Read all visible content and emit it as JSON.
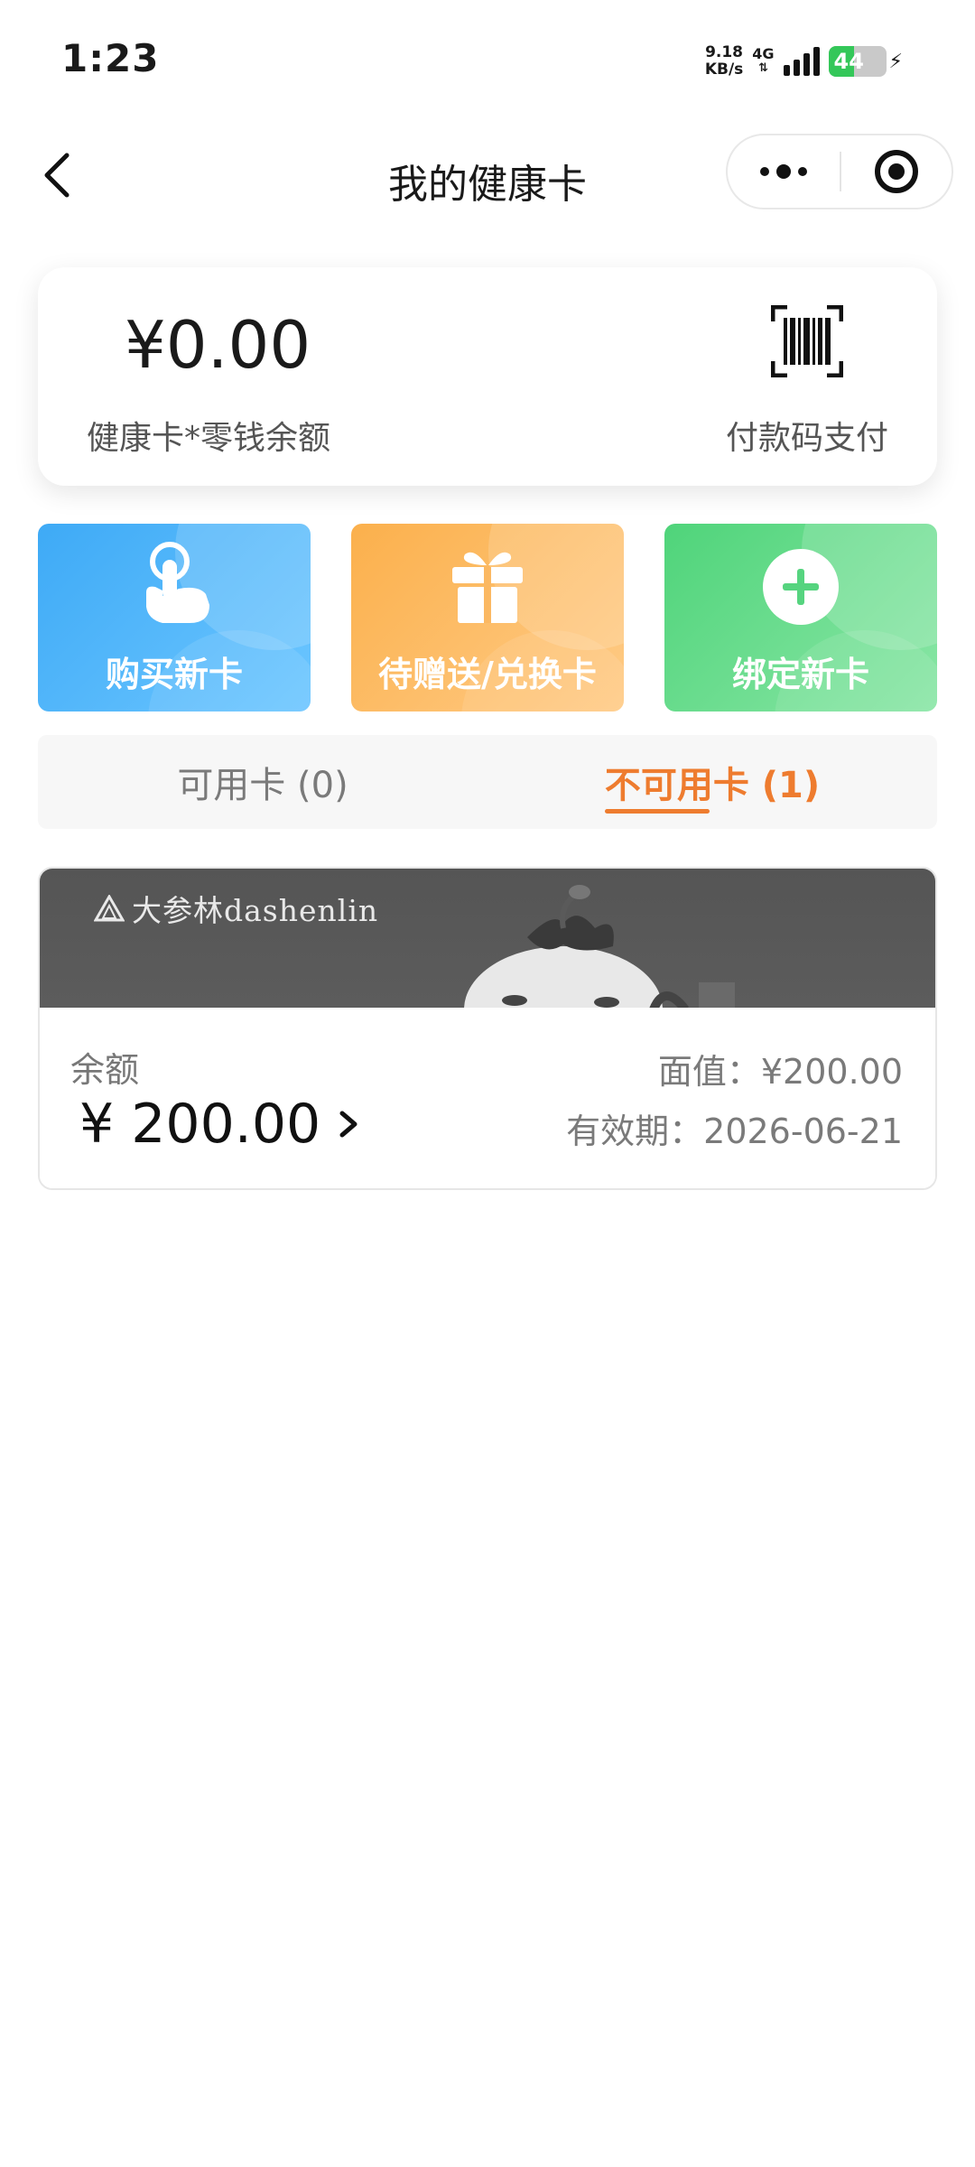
{
  "status_bar": {
    "time": "1:23",
    "net_speed_value": "9.18",
    "net_speed_unit": "KB/s",
    "network": "4G",
    "battery": "44",
    "battery_level": 0.44
  },
  "nav": {
    "title": "我的健康卡",
    "back_icon": "chevron-left-icon",
    "more_icon": "more-dots-icon",
    "close_icon": "target-circle-icon"
  },
  "balance": {
    "amount": "¥0.00",
    "label": "健康卡*零钱余额",
    "paycode_label": "付款码支付",
    "paycode_icon": "barcode-scan-icon"
  },
  "actions": [
    {
      "label": "购买新卡",
      "icon": "tap-hand-icon",
      "color": "#3eaaf6"
    },
    {
      "label": "待赠送/兑换卡",
      "icon": "gift-icon",
      "color": "#fbb04c"
    },
    {
      "label": "绑定新卡",
      "icon": "plus-circle-icon",
      "color": "#4fd47a"
    }
  ],
  "tabs": {
    "available": "可用卡 (0)",
    "unavailable": "不可用卡 (1)",
    "active_color": "#ee7c2f"
  },
  "card": {
    "brand": "大参林dashenlin",
    "balance_label": "余额",
    "balance_value": "¥ 200.00",
    "face_value": "面值：¥200.00",
    "expiry": "有效期：2026-06-21"
  }
}
